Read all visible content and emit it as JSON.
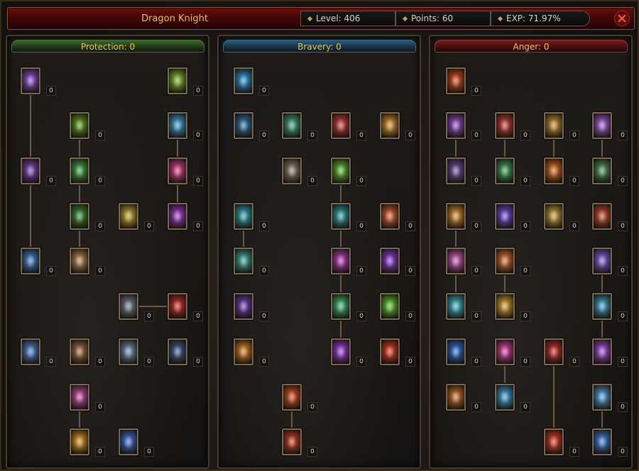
{
  "header": {
    "class_name": "Dragon Knight",
    "level_text": "Level: 406",
    "points_text": "Points: 60",
    "exp_text": "EXP:  71.97%"
  },
  "trees": [
    {
      "name": "Protection",
      "title": "Protection: 0",
      "accent": "#3a6a2a",
      "skills": [
        {
          "icon": "archer-icon",
          "color": "#8a4ad0",
          "points": 0
        },
        {
          "icon": "strength-arm-icon",
          "color": "#7ab030",
          "points": 0
        },
        {
          "icon": "green-banner-icon",
          "color": "#5a9a20",
          "points": 0
        },
        {
          "icon": "ice-wing-icon",
          "color": "#3a9ad0",
          "points": 0
        },
        {
          "icon": "purple-knight-icon",
          "color": "#7a40b0",
          "points": 0
        },
        {
          "icon": "green-arrow-icon",
          "color": "#3aa040",
          "points": 0
        },
        {
          "icon": "pink-heart-icon",
          "color": "#d03a8a",
          "points": 0
        },
        {
          "icon": "green-shield-icon",
          "color": "#3a8a30",
          "points": 0
        },
        {
          "icon": "golden-shield-icon",
          "color": "#c0a030",
          "points": 0
        },
        {
          "icon": "purple-orb-icon",
          "color": "#9a3ac0",
          "points": 0
        },
        {
          "icon": "blue-blast-icon",
          "color": "#3a7ac0",
          "points": 0
        },
        {
          "icon": "guardian-icon",
          "color": "#b08050",
          "points": 0
        },
        {
          "icon": "dark-knight-icon",
          "color": "#707a8a",
          "points": 0
        },
        {
          "icon": "red-claw-icon",
          "color": "#c02a2a",
          "points": 0
        },
        {
          "icon": "blue-cross-icon",
          "color": "#4a7ac0",
          "points": 0
        },
        {
          "icon": "bronze-warrior-icon",
          "color": "#9a6a40",
          "points": 0
        },
        {
          "icon": "ghost-knight-icon",
          "color": "#6a8ab0",
          "points": 0
        },
        {
          "icon": "shadow-fighter-icon",
          "color": "#3a5a8a",
          "points": 0
        },
        {
          "icon": "pink-wing-icon",
          "color": "#c04aa0",
          "points": 0
        },
        {
          "icon": "golden-wing-icon",
          "color": "#d09020",
          "points": 0
        },
        {
          "icon": "blue-warrior-icon",
          "color": "#3a6ad0",
          "points": 0
        }
      ]
    },
    {
      "name": "Bravery",
      "title": "Bravery: 0",
      "accent": "#2a5a7a",
      "skills": [
        {
          "icon": "blue-rune-icon",
          "color": "#2a90d0",
          "points": 0
        },
        {
          "icon": "blue-silhouette-icon",
          "color": "#2a70a0",
          "points": 0
        },
        {
          "icon": "green-slash-icon",
          "color": "#3aa080",
          "points": 0
        },
        {
          "icon": "red-blade-icon",
          "color": "#c03a3a",
          "points": 0
        },
        {
          "icon": "golden-star-icon",
          "color": "#d09030",
          "points": 0
        },
        {
          "icon": "triple-spear-icon",
          "color": "#8a7a6a",
          "points": 0
        },
        {
          "icon": "green-rune-icon",
          "color": "#5ab030",
          "points": 0
        },
        {
          "icon": "teal-arrow-icon",
          "color": "#2aa0b0",
          "points": 0
        },
        {
          "icon": "teal-orb-icon",
          "color": "#2a9aa0",
          "points": 0
        },
        {
          "icon": "lightning-icon",
          "color": "#d05a30",
          "points": 0
        },
        {
          "icon": "teal-dash-icon",
          "color": "#3aa090",
          "points": 0
        },
        {
          "icon": "magenta-orb-icon",
          "color": "#b03ab0",
          "points": 0
        },
        {
          "icon": "violet-burst-icon",
          "color": "#8a3ad0",
          "points": 0
        },
        {
          "icon": "purple-flame-icon",
          "color": "#6a3ab0",
          "points": 0
        },
        {
          "icon": "green-spark-icon",
          "color": "#3ab070",
          "points": 0
        },
        {
          "icon": "green-swirl-icon",
          "color": "#5ac030",
          "points": 0
        },
        {
          "icon": "fire-kick-icon",
          "color": "#d07a20",
          "points": 0
        },
        {
          "icon": "purple-shard-icon",
          "color": "#9a3ad0",
          "points": 0
        },
        {
          "icon": "red-slash-icon",
          "color": "#d03a20",
          "points": 0
        },
        {
          "icon": "fire-strike-icon",
          "color": "#d04a20",
          "points": 0
        },
        {
          "icon": "fire-burst-icon",
          "color": "#c03a20",
          "points": 0
        }
      ]
    },
    {
      "name": "Anger",
      "title": "Anger: 0",
      "accent": "#7a1a1a",
      "skills": [
        {
          "icon": "fist-icon",
          "color": "#d04a20",
          "points": 0
        },
        {
          "icon": "violet-paladin-icon",
          "color": "#8a4ac0",
          "points": 0
        },
        {
          "icon": "red-sword-icon",
          "color": "#c03a3a",
          "points": 0
        },
        {
          "icon": "golden-hammer-icon",
          "color": "#c08a30",
          "points": 0
        },
        {
          "icon": "violet-spear-icon",
          "color": "#9a5ad0",
          "points": 0
        },
        {
          "icon": "dark-paladin-icon",
          "color": "#6a4a9a",
          "points": 0
        },
        {
          "icon": "green-sword-icon",
          "color": "#3a9a5a",
          "points": 0
        },
        {
          "icon": "fire-hammer-icon",
          "color": "#d06a20",
          "points": 0
        },
        {
          "icon": "green-spear-icon",
          "color": "#4a8a5a",
          "points": 0
        },
        {
          "icon": "flame-aura-icon",
          "color": "#d08a30",
          "points": 0
        },
        {
          "icon": "atom-icon",
          "color": "#6a4ad0",
          "points": 0
        },
        {
          "icon": "sun-crest-icon",
          "color": "#c09a3a",
          "points": 0
        },
        {
          "icon": "red-crest-icon",
          "color": "#c04a2a",
          "points": 0
        },
        {
          "icon": "pink-crest-icon",
          "color": "#c05ab0",
          "points": 0
        },
        {
          "icon": "fire-feather-icon",
          "color": "#d06a30",
          "points": 0
        },
        {
          "icon": "violet-crest-icon",
          "color": "#7a5ad0",
          "points": 0
        },
        {
          "icon": "cyan-crest-icon",
          "color": "#3ab0c0",
          "points": 0
        },
        {
          "icon": "amber-shard-icon",
          "color": "#d09a30",
          "points": 0
        },
        {
          "icon": "cyan-wing-icon",
          "color": "#3a9ac0",
          "points": 0
        },
        {
          "icon": "blue-flash-icon",
          "color": "#2a6ad0",
          "points": 0
        },
        {
          "icon": "magenta-heart-icon",
          "color": "#d03a9a",
          "points": 0
        },
        {
          "icon": "red-figure-icon",
          "color": "#c02a2a",
          "points": 0
        },
        {
          "icon": "violet-scroll-icon",
          "color": "#9a4ad0",
          "points": 0
        },
        {
          "icon": "dice-icon",
          "color": "#c06a2a",
          "points": 0
        },
        {
          "icon": "crystal-icon",
          "color": "#3a9ad0",
          "points": 0
        },
        {
          "icon": "cyan-blade-icon",
          "color": "#4a9ad0",
          "points": 0
        },
        {
          "icon": "fire-figure-icon",
          "color": "#d03a20",
          "points": 0
        },
        {
          "icon": "blue-shield-icon",
          "color": "#3a7ad0",
          "points": 0
        }
      ]
    }
  ]
}
